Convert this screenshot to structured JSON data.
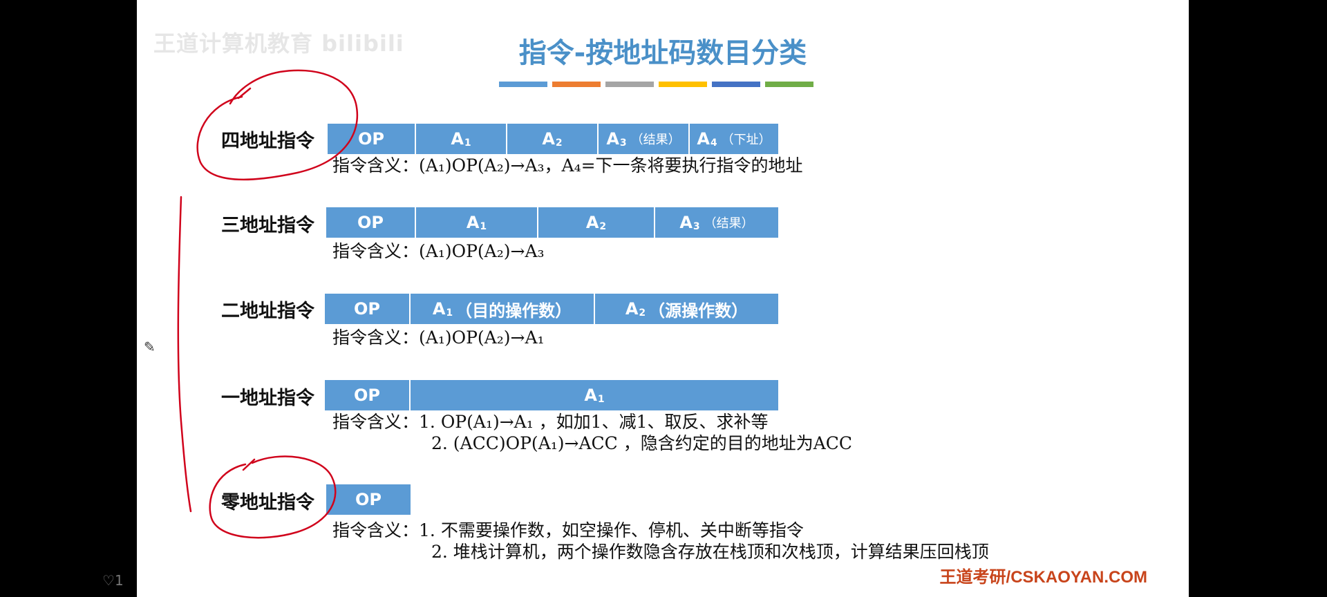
{
  "slide": {
    "watermark": "王道计算机教育 bilibili",
    "title": "指令-按地址码数目分类",
    "title_bar_colors": [
      "#5b9bd5",
      "#ed7d31",
      "#a5a5a5",
      "#ffc000",
      "#4472c4",
      "#70ad47"
    ],
    "brand": "王道考研/CSKAOYAN.COM"
  },
  "four_addr": {
    "label": "四地址指令",
    "fields": {
      "op": "OP",
      "a1": "A",
      "a1_sub": "1",
      "a2": "A",
      "a2_sub": "2",
      "a3": "A",
      "a3_sub": "3",
      "a3_note": "（结果）",
      "a4": "A",
      "a4_sub": "4",
      "a4_note": "（下址）"
    },
    "meaning_label": "指令含义：",
    "meaning": "(A₁)OP(A₂)→A₃，A₄=下一条将要执行指令的地址"
  },
  "three_addr": {
    "label": "三地址指令",
    "fields": {
      "op": "OP",
      "a1": "A",
      "a1_sub": "1",
      "a2": "A",
      "a2_sub": "2",
      "a3": "A",
      "a3_sub": "3",
      "a3_note": "（结果）"
    },
    "meaning_label": "指令含义：",
    "meaning": "(A₁)OP(A₂)→A₃"
  },
  "two_addr": {
    "label": "二地址指令",
    "fields": {
      "op": "OP",
      "a1": "A",
      "a1_sub": "1",
      "a1_note": "（目的操作数）",
      "a2": "A",
      "a2_sub": "2",
      "a2_note": "（源操作数）"
    },
    "meaning_label": "指令含义：",
    "meaning": "(A₁)OP(A₂)→A₁"
  },
  "one_addr": {
    "label": "一地址指令",
    "fields": {
      "op": "OP",
      "a1": "A",
      "a1_sub": "1"
    },
    "meaning_label": "指令含义：",
    "meaning_1": "1. OP(A₁)→A₁ ，如加1、减1、取反、求补等",
    "meaning_2": "2. (ACC)OP(A₁)→ACC ，隐含约定的目的地址为ACC"
  },
  "zero_addr": {
    "label": "零地址指令",
    "fields": {
      "op": "OP"
    },
    "meaning_label": "指令含义：",
    "meaning_1": "1. 不需要操作数，如空操作、停机、关中断等指令",
    "meaning_2": "2. 堆栈计算机，两个操作数隐含存放在栈顶和次栈顶，计算结果压回栈顶"
  },
  "overlay": {
    "bottom_left_icon": "comment-icon",
    "bottom_left_text": "1",
    "cursor_icon": "pencil-icon",
    "annotation_color": "#d0021b"
  }
}
